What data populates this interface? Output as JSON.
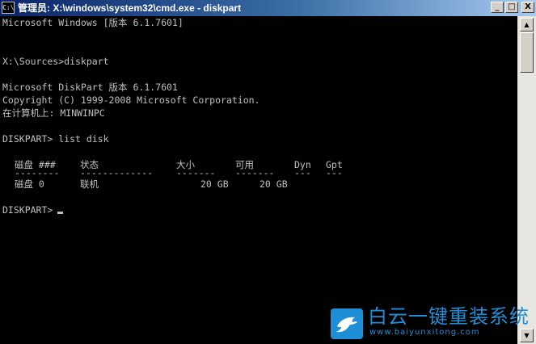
{
  "window": {
    "title": "管理员: X:\\windows\\system32\\cmd.exe - diskpart",
    "icon_text": "C:\\",
    "buttons": {
      "minimize": "_",
      "maximize": "□",
      "close": "X"
    }
  },
  "console": {
    "lines": [
      "Microsoft Windows [版本 6.1.7601]",
      "",
      "",
      "X:\\Sources>diskpart",
      "",
      "Microsoft DiskPart 版本 6.1.7601",
      "Copyright (C) 1999-2008 Microsoft Corporation.",
      "在计算机上: MINWINPC",
      "",
      "DISKPART> list disk",
      ""
    ],
    "table": {
      "headers": [
        "磁盘 ###",
        "状态",
        "大小",
        "可用",
        "Dyn",
        "Gpt"
      ],
      "separators": [
        "--------",
        "-------------",
        "-------",
        "-------",
        "---",
        "---"
      ],
      "rows": [
        [
          "磁盘 0",
          "联机",
          "20 GB",
          "20 GB",
          "",
          ""
        ]
      ]
    },
    "prompt": "DISKPART>"
  },
  "scrollbar": {
    "up_arrow": "▲",
    "down_arrow": "▼"
  },
  "watermark": {
    "title": "白云一键重装系统",
    "url": "www.baiyunxitong.com",
    "brand_color": "#1e8fd6"
  }
}
